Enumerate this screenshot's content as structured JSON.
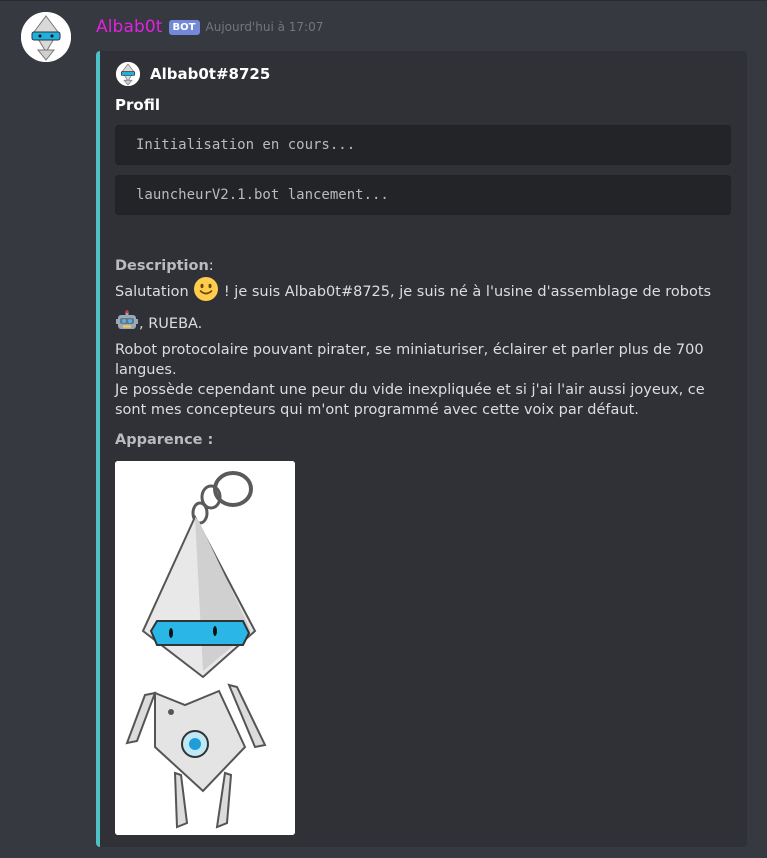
{
  "message": {
    "username": "Albab0t",
    "bot_tag": "BOT",
    "timestamp": "Aujourd'hui à 17:07"
  },
  "embed": {
    "color": "#4fc1c6",
    "author_name": "Albab0t#8725",
    "title": "Profil",
    "code_lines": [
      "Initialisation en cours...",
      "launcheurV2.1.bot lancement..."
    ],
    "description_label": "Description",
    "description": {
      "colon": ":",
      "line1_a": "Salutation",
      "line1_b": "! je suis Albab0t#8725, je suis né à l'usine d'assemblage de robots",
      "line2": ", RUEBA.",
      "line3": "Robot protocolaire pouvant pirater, se miniaturiser, éclairer et parler plus de 700 langues.",
      "line4": "Je possède cependant une peur du vide inexpliquée et si j'ai l'air aussi joyeux, ce sont mes concepteurs qui m'ont programmé avec cette voix par défaut."
    },
    "apparence_label": "Apparence :",
    "icons": {
      "smile_emoji": "slightly-smiling-face",
      "robot_emoji": "robot-face"
    }
  }
}
